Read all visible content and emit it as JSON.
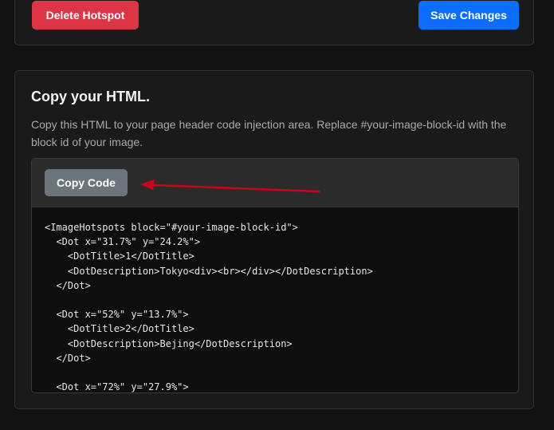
{
  "top_card": {
    "delete_label": "Delete Hotspot",
    "save_label": "Save Changes"
  },
  "copy_section": {
    "title": "Copy your HTML.",
    "description": "Copy this HTML to your page header code injection area. Replace #your-image-block-id with the block id of your image.",
    "copy_button_label": "Copy Code",
    "code_lines": [
      "<ImageHotspots block=\"#your-image-block-id\">",
      "  <Dot x=\"31.7%\" y=\"24.2%\">",
      "    <DotTitle>1</DotTitle>",
      "    <DotDescription>Tokyo<div><br></div></DotDescription>",
      "  </Dot>",
      "",
      "  <Dot x=\"52%\" y=\"13.7%\">",
      "    <DotTitle>2</DotTitle>",
      "    <DotDescription>Bejing</DotDescription>",
      "  </Dot>",
      "",
      "  <Dot x=\"72%\" y=\"27.9%\">"
    ]
  },
  "colors": {
    "background": "#121212",
    "card": "#1a1a1a",
    "delete": "#dc3545",
    "save": "#0d6efd",
    "copy": "#6c757d",
    "arrow": "#d0021b"
  },
  "annotation": {
    "arrow_icon": "red-arrow-icon"
  }
}
